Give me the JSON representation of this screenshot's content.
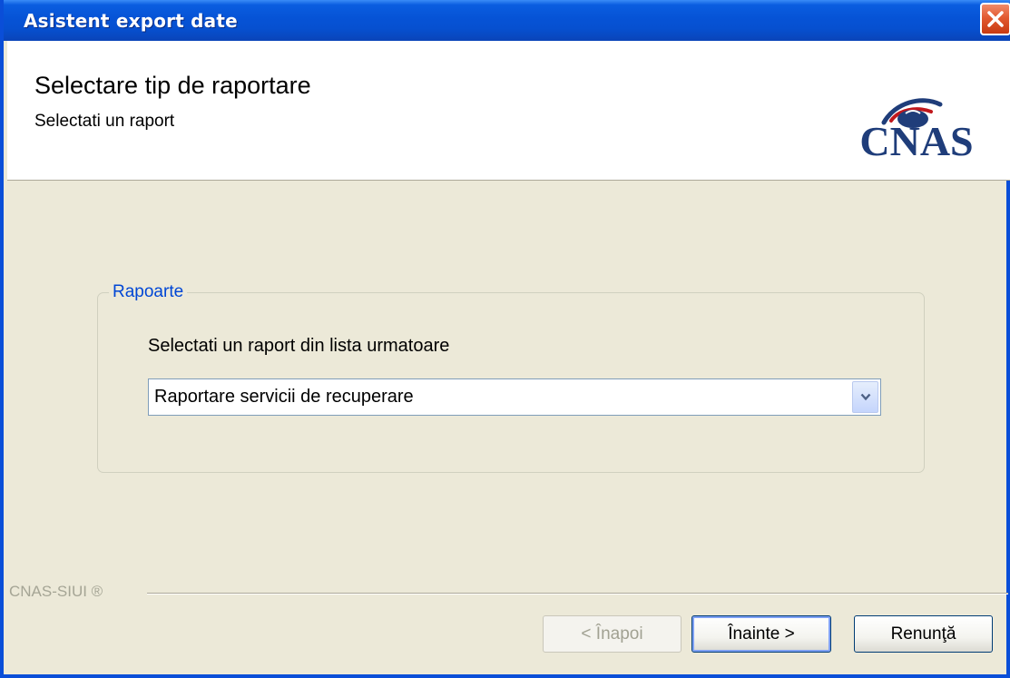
{
  "window": {
    "title": "Asistent export date"
  },
  "header": {
    "title": "Selectare tip de raportare",
    "subtitle": "Selectati un raport",
    "logo_text": "CNAS"
  },
  "group": {
    "legend": "Rapoarte",
    "instruction": "Selectati un raport din lista urmatoare",
    "selected_value": "Raportare servicii de recuperare"
  },
  "footer": {
    "brand": "CNAS-SIUI ®",
    "back_label": "< Înapoi",
    "next_label": "Înainte >",
    "cancel_label": "Renunţă"
  },
  "colors": {
    "titlebar": "#0653d6",
    "legend": "#0046d5",
    "logo": "#1f3d7a",
    "logo_accent": "#c0181d"
  },
  "icons": {
    "close": "close-icon",
    "dropdown": "chevron-down-icon"
  }
}
